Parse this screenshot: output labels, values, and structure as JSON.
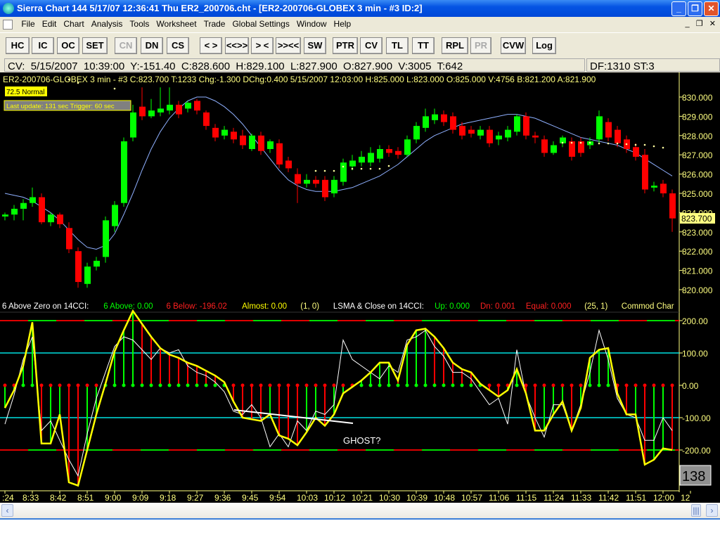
{
  "window": {
    "title": "Sierra Chart 144  5/17/07  12:36:41  Thu    ER2_200706.cht - [ER2-200706-GLOBEX  3 min  - #3  ID:2]"
  },
  "menu": [
    "File",
    "Edit",
    "Chart",
    "Analysis",
    "Tools",
    "Worksheet",
    "Trade",
    "Global Settings",
    "Window",
    "Help"
  ],
  "toolbar": [
    {
      "label": "HC"
    },
    {
      "label": "IC"
    },
    {
      "label": "OC"
    },
    {
      "label": "SET"
    },
    {
      "label": "CN",
      "disabled": true
    },
    {
      "label": "DN"
    },
    {
      "label": "CS"
    },
    {
      "label": "< >"
    },
    {
      "label": "<<>>"
    },
    {
      "label": "> <"
    },
    {
      "label": ">><<"
    },
    {
      "label": "SW"
    },
    {
      "label": "PTR"
    },
    {
      "label": "CV"
    },
    {
      "label": "TL"
    },
    {
      "label": "TT"
    },
    {
      "label": "RPL"
    },
    {
      "label": "PR",
      "disabled": true
    },
    {
      "label": "CVW"
    },
    {
      "label": "Log"
    }
  ],
  "infobar": {
    "cv": "CV:  5/15/2007  10:39:00  Y:-151.40  C:828.600  H:829.100  L:827.900  O:827.900  V:3005  T:642",
    "df": "DF:1310  ST:3"
  },
  "chart_header": "ER2-200706-GLOBEX  3 min  - #3   C:823.700  T:1233  Chg:-1.300  DChg:0.400  5/15/2007  12:03:00  H:825.000  L:823.000  O:825.000  V:4756  B:821.200  A:821.900",
  "badges": {
    "normal": "72.5 Normal",
    "update": "Last update: 131 sec   Trigger: 60 sec"
  },
  "last_price": "823.700",
  "indicator_header": [
    {
      "text": "6 Above Zero on 14CCI:",
      "color": "#ffffff"
    },
    {
      "text": "6 Above: 0.00",
      "color": "#00ff00"
    },
    {
      "text": "6 Below: -196.02",
      "color": "#ff2020"
    },
    {
      "text": "Almost: 0.00",
      "color": "#ffff00"
    },
    {
      "text": "(1, 0)",
      "color": "#ffff80"
    },
    {
      "text": "LSMA & Close on 14CCI:",
      "color": "#ffffff"
    },
    {
      "text": "Up: 0.000",
      "color": "#00ff00"
    },
    {
      "text": "Dn: 0.001",
      "color": "#ff2020"
    },
    {
      "text": "Equal: 0.000",
      "color": "#ff2020"
    },
    {
      "text": "(25, 1)",
      "color": "#ffff80"
    },
    {
      "text": "Commod Char",
      "color": "#ffff80"
    }
  ],
  "annotation": "GHOST?",
  "bar_counter": "138",
  "colors": {
    "up": "#00ff00",
    "down": "#ff0000",
    "ma": "#8fb0ff",
    "lsma": "#ffff00",
    "cci": "#ffffff",
    "cyan": "#00e0e0",
    "axis": "#ffff80"
  },
  "chart_data": [
    {
      "type": "candlestick",
      "price_ticks": [
        "830.000",
        "829.000",
        "828.000",
        "827.000",
        "826.000",
        "825.000",
        "824.000",
        "823.000",
        "822.000",
        "821.000",
        "820.000"
      ],
      "ylim": [
        819.8,
        830.6
      ],
      "time_ticks": [
        ":24",
        "8:33",
        "8:42",
        "8:51",
        "9:00",
        "9:09",
        "9:18",
        "9:27",
        "9:36",
        "9:45",
        "9:54",
        "10:03",
        "10:12",
        "10:21",
        "10:30",
        "10:39",
        "10:48",
        "10:57",
        "11:06",
        "11:15",
        "11:24",
        "11:33",
        "11:42",
        "11:51",
        "12:00",
        "12"
      ],
      "ohlc": [
        [
          823.8,
          824.0,
          823.6,
          823.9
        ],
        [
          823.9,
          824.4,
          823.6,
          824.2
        ],
        [
          824.2,
          824.7,
          823.6,
          824.5
        ],
        [
          824.5,
          825.3,
          824.3,
          824.8
        ],
        [
          824.8,
          825.0,
          823.4,
          823.5
        ],
        [
          823.5,
          824.0,
          823.3,
          823.9
        ],
        [
          823.9,
          824.0,
          823.2,
          823.4
        ],
        [
          823.2,
          823.5,
          821.9,
          822.1
        ],
        [
          822.0,
          822.2,
          820.1,
          820.4
        ],
        [
          820.3,
          821.4,
          820.1,
          821.2
        ],
        [
          821.2,
          821.7,
          821.0,
          821.5
        ],
        [
          821.7,
          823.8,
          821.4,
          823.6
        ],
        [
          823.3,
          824.6,
          823.0,
          824.4
        ],
        [
          824.5,
          827.9,
          824.3,
          827.7
        ],
        [
          827.9,
          829.6,
          827.7,
          829.2
        ],
        [
          829.5,
          830.5,
          828.8,
          829.0
        ],
        [
          829.0,
          829.9,
          828.9,
          829.3
        ],
        [
          829.2,
          830.5,
          829.0,
          829.4
        ],
        [
          829.3,
          830.5,
          829.1,
          829.6
        ],
        [
          829.6,
          829.8,
          828.9,
          829.1
        ],
        [
          829.4,
          829.8,
          829.2,
          829.7
        ],
        [
          829.8,
          829.9,
          829.1,
          829.3
        ],
        [
          829.2,
          829.3,
          828.3,
          828.5
        ],
        [
          828.4,
          828.6,
          827.7,
          827.9
        ],
        [
          828.0,
          828.5,
          827.8,
          828.3
        ],
        [
          828.2,
          828.4,
          827.6,
          827.8
        ],
        [
          828.0,
          828.3,
          827.3,
          827.5
        ],
        [
          827.3,
          828.1,
          827.2,
          828.0
        ],
        [
          828.0,
          828.2,
          827.0,
          827.2
        ],
        [
          827.3,
          827.8,
          827.1,
          827.7
        ],
        [
          827.6,
          827.8,
          826.3,
          826.5
        ],
        [
          826.7,
          826.9,
          826.1,
          826.3
        ],
        [
          826.0,
          826.3,
          824.5,
          825.5
        ],
        [
          825.5,
          826.0,
          825.3,
          825.7
        ],
        [
          825.7,
          825.9,
          825.3,
          825.5
        ],
        [
          825.7,
          825.9,
          824.6,
          824.8
        ],
        [
          825.0,
          825.9,
          824.8,
          825.7
        ],
        [
          825.6,
          826.8,
          825.4,
          826.6
        ],
        [
          826.4,
          827.0,
          826.2,
          826.7
        ],
        [
          826.6,
          827.2,
          826.4,
          826.9
        ],
        [
          826.6,
          827.4,
          826.4,
          827.1
        ],
        [
          826.8,
          827.5,
          826.6,
          827.3
        ],
        [
          827.3,
          827.5,
          826.9,
          827.1
        ],
        [
          827.2,
          827.4,
          826.8,
          827.0
        ],
        [
          827.0,
          828.0,
          826.9,
          827.8
        ],
        [
          827.8,
          828.7,
          827.6,
          828.5
        ],
        [
          828.4,
          829.4,
          828.2,
          829.0
        ],
        [
          828.8,
          829.4,
          828.6,
          829.1
        ],
        [
          829.1,
          829.3,
          828.5,
          828.7
        ],
        [
          829.0,
          829.2,
          828.1,
          828.3
        ],
        [
          828.5,
          828.7,
          827.8,
          828.0
        ],
        [
          828.3,
          828.5,
          827.9,
          828.1
        ],
        [
          828.0,
          828.5,
          827.8,
          828.3
        ],
        [
          828.3,
          828.5,
          827.4,
          827.6
        ],
        [
          827.8,
          828.2,
          827.5,
          828.0
        ],
        [
          827.9,
          828.5,
          827.7,
          828.3
        ],
        [
          828.2,
          829.1,
          828.0,
          829.0
        ],
        [
          829.0,
          829.2,
          827.8,
          828.0
        ],
        [
          828.0,
          828.2,
          827.6,
          827.9
        ],
        [
          827.8,
          828.0,
          826.9,
          827.1
        ],
        [
          827.1,
          827.7,
          827.0,
          827.5
        ],
        [
          827.6,
          828.0,
          827.4,
          827.9
        ],
        [
          827.7,
          827.9,
          826.7,
          826.9
        ],
        [
          827.7,
          827.9,
          826.9,
          827.1
        ],
        [
          827.5,
          827.9,
          827.3,
          827.7
        ],
        [
          827.8,
          829.3,
          827.6,
          829.0
        ],
        [
          828.7,
          828.9,
          827.7,
          827.9
        ],
        [
          828.3,
          828.5,
          827.4,
          827.6
        ],
        [
          827.8,
          828.0,
          827.1,
          827.3
        ],
        [
          827.4,
          827.6,
          826.7,
          826.9
        ],
        [
          827.0,
          827.3,
          825.0,
          825.2
        ],
        [
          825.3,
          825.6,
          825.1,
          825.4
        ],
        [
          825.5,
          825.7,
          824.8,
          825.0
        ],
        [
          825.0,
          825.2,
          823.0,
          823.7
        ]
      ],
      "ma": [
        825.0,
        824.9,
        824.8,
        824.6,
        824.3,
        824.0,
        823.6,
        823.1,
        822.6,
        822.2,
        822.1,
        822.3,
        822.9,
        823.9,
        825.0,
        826.2,
        827.3,
        828.2,
        828.9,
        829.4,
        829.8,
        830.0,
        830.0,
        829.8,
        829.5,
        829.1,
        828.6,
        828.0,
        827.4,
        826.8,
        826.2,
        825.7,
        825.4,
        825.2,
        825.1,
        825.1,
        825.1,
        825.2,
        825.3,
        825.5,
        825.7,
        825.9,
        826.2,
        826.5,
        826.9,
        827.3,
        827.7,
        828.0,
        828.2,
        828.4,
        828.6,
        828.7,
        828.8,
        828.9,
        829.0,
        829.1,
        829.1,
        829.0,
        828.9,
        828.7,
        828.5,
        828.3,
        828.1,
        827.9,
        827.8,
        827.7,
        827.6,
        827.5,
        827.3,
        827.1,
        826.8,
        826.5,
        826.2,
        825.9
      ]
    },
    {
      "type": "line",
      "ticks": [
        "200.00",
        "100.00",
        "0.00",
        "-100.00",
        "-200.00"
      ],
      "ylim": [
        -320,
        240
      ],
      "lsma": [
        -70,
        -15,
        60,
        195,
        -180,
        -180,
        -90,
        -300,
        -310,
        -200,
        -90,
        5,
        105,
        170,
        230,
        190,
        150,
        115,
        95,
        85,
        70,
        60,
        45,
        30,
        10,
        -50,
        -100,
        -105,
        -110,
        -90,
        -155,
        -165,
        -185,
        -145,
        -100,
        -125,
        -90,
        -25,
        -5,
        15,
        40,
        70,
        70,
        15,
        125,
        170,
        175,
        150,
        115,
        70,
        50,
        40,
        5,
        -15,
        -35,
        -15,
        50,
        -25,
        -140,
        -140,
        -90,
        -50,
        -140,
        -70,
        85,
        110,
        115,
        -25,
        -90,
        -90,
        -245,
        -230,
        -195,
        -200
      ],
      "cci": [
        -120,
        -30,
        80,
        150,
        -140,
        -110,
        -170,
        -230,
        -280,
        -150,
        -40,
        40,
        120,
        150,
        140,
        110,
        80,
        115,
        100,
        110,
        60,
        40,
        30,
        10,
        -20,
        -80,
        -90,
        -60,
        -100,
        -190,
        -150,
        -190,
        -110,
        -140,
        -80,
        -90,
        -60,
        140,
        80,
        60,
        40,
        20,
        60,
        40,
        140,
        150,
        170,
        120,
        90,
        40,
        40,
        20,
        -20,
        -60,
        -40,
        -120,
        110,
        -30,
        -100,
        -160,
        -60,
        -60,
        -140,
        -60,
        40,
        170,
        80,
        -40,
        -90,
        -100,
        -170,
        -170,
        -100,
        -140
      ]
    }
  ]
}
